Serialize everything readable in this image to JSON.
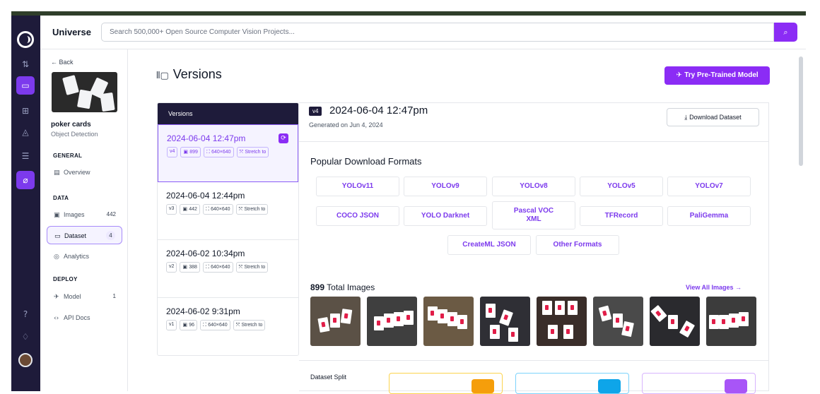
{
  "header": {
    "brand": "Universe",
    "search_placeholder": "Search 500,000+ Open Source Computer Vision Projects..."
  },
  "sidebar": {
    "back_label": "Back",
    "project_name": "poker cards",
    "project_type": "Object Detection",
    "sections": {
      "general": "GENERAL",
      "data": "DATA",
      "deploy": "DEPLOY"
    },
    "items": [
      {
        "label": "Overview",
        "icon": "overview-icon",
        "count": ""
      },
      {
        "label": "Images",
        "icon": "images-icon",
        "count": "442"
      },
      {
        "label": "Dataset",
        "icon": "dataset-icon",
        "count": "4"
      },
      {
        "label": "Analytics",
        "icon": "analytics-icon",
        "count": ""
      },
      {
        "label": "Model",
        "icon": "model-icon",
        "count": "1"
      },
      {
        "label": "API Docs",
        "icon": "code-icon",
        "count": ""
      }
    ]
  },
  "main": {
    "title": "Versions",
    "try_button": "Try Pre-Trained Model"
  },
  "versions": {
    "header": "Versions",
    "list": [
      {
        "date": "2024-06-04 12:47pm",
        "ver": "v4",
        "images": "899",
        "size": "640×640",
        "preprocess": "Stretch to"
      },
      {
        "date": "2024-06-04 12:44pm",
        "ver": "v3",
        "images": "442",
        "size": "640×640",
        "preprocess": "Stretch to"
      },
      {
        "date": "2024-06-02 10:34pm",
        "ver": "v2",
        "images": "388",
        "size": "640×640",
        "preprocess": "Stretch to"
      },
      {
        "date": "2024-06-02 9:31pm",
        "ver": "v1",
        "images": "96",
        "size": "640×640",
        "preprocess": "Stretch to"
      }
    ]
  },
  "detail": {
    "badge": "v4",
    "title": "2024-06-04 12:47pm",
    "generated": "Generated on Jun 4, 2024",
    "download": "Download Dataset",
    "popular_title": "Popular Download Formats",
    "formats": [
      "YOLOv11",
      "YOLOv9",
      "YOLOv8",
      "YOLOv5",
      "YOLOv7",
      "COCO JSON",
      "YOLO Darknet",
      "Pascal VOC XML",
      "TFRecord",
      "PaliGemma",
      "CreateML JSON",
      "Other Formats"
    ],
    "total_count": "899",
    "total_label": "Total Images",
    "view_all": "View All Images →",
    "split_label": "Dataset Split"
  },
  "colors": {
    "accent": "#8b2cf5",
    "rail": "#1e1b3a",
    "train": "#f59e0b",
    "valid": "#0ea5e9",
    "test": "#a855f7"
  }
}
